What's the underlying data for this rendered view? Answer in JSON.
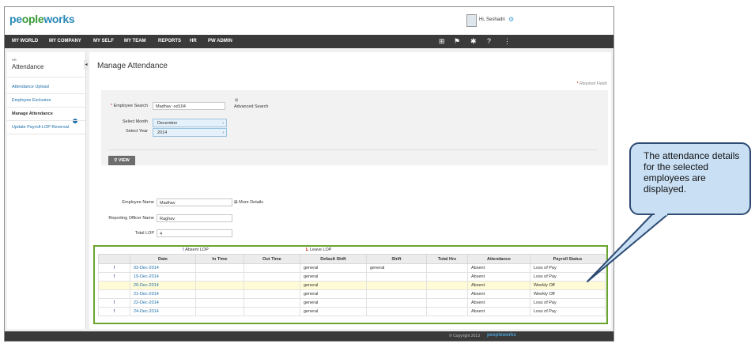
{
  "app": {
    "logo_part1": "pe",
    "logo_part2": "ople",
    "logo_part3": "works"
  },
  "user": {
    "greeting": "Hi, Seshadri"
  },
  "nav": {
    "items": [
      "MY WORLD",
      "MY COMPANY",
      "MY SELF",
      "MY TEAM",
      "REPORTS",
      "HR",
      "PW ADMIN"
    ],
    "icons": [
      "book-icon",
      "flag-icon",
      "tools-icon",
      "help-icon",
      "sitemap-icon"
    ]
  },
  "sidebar": {
    "section": "HR",
    "title": "Attendance",
    "items": [
      "Attendance Upload",
      "Employee Exclusion",
      "Manage Attendance",
      "Update Payroll-LOP Reversal"
    ]
  },
  "main": {
    "title": "Manage Attendance",
    "required_note": "Required Fields",
    "employee_search_label": "Employee Search",
    "employee_search_value": "Madhav -xd104",
    "advanced_search": "Advanced Search",
    "month_label": "Select Month",
    "month_value": "December",
    "year_label": "Select Year",
    "year_value": "2014",
    "view_button": "VIEW",
    "employee_name_label": "Employee Name",
    "employee_name_value": "Madhav",
    "more_details": "More Details",
    "reporting_officer_label": "Reporting Officer Name",
    "reporting_officer_value": "Raghav",
    "total_lop_label": "Total LOP",
    "total_lop_value": "4"
  },
  "legend": {
    "absent_lop": "Absent LOP",
    "leave_lop": "Leave LOP",
    "absent_mark": "!",
    "leave_mark": "L"
  },
  "table": {
    "headers": [
      "",
      "Date",
      "In Time",
      "Out Time",
      "Default Shift",
      "Shift",
      "Total Hrs",
      "Attendance",
      "Payroll Status"
    ],
    "rows": [
      [
        "!",
        "03-Dec-2014",
        "",
        "",
        "general",
        "general",
        "",
        "Absent",
        "Loss of Pay"
      ],
      [
        "!",
        "19-Dec-2014",
        "",
        "",
        "general",
        "",
        "",
        "Absent",
        "Loss of Pay"
      ],
      [
        "",
        "20-Dec-2014",
        "",
        "",
        "general",
        "",
        "",
        "Absent",
        "Weekly Off"
      ],
      [
        "",
        "21-Dec-2014",
        "",
        "",
        "general",
        "",
        "",
        "Absent",
        "Weekly Off"
      ],
      [
        "!",
        "22-Dec-2014",
        "",
        "",
        "general",
        "",
        "",
        "Absent",
        "Loss of Pay"
      ],
      [
        "!",
        "24-Dec-2014",
        "",
        "",
        "general",
        "",
        "",
        "Absent",
        "Loss of Pay"
      ]
    ]
  },
  "footer": {
    "copyright": "© Copyright 2013",
    "logo": "peopleworks"
  },
  "callout": {
    "text": "The attendance details for the selected employees are displayed."
  },
  "colors": {
    "accent": "#1a6da8",
    "nav_bg": "#3a3a3a",
    "highlight_border": "#6aa42f",
    "callout_bg": "#c8dff4",
    "callout_border": "#2d4b73"
  }
}
